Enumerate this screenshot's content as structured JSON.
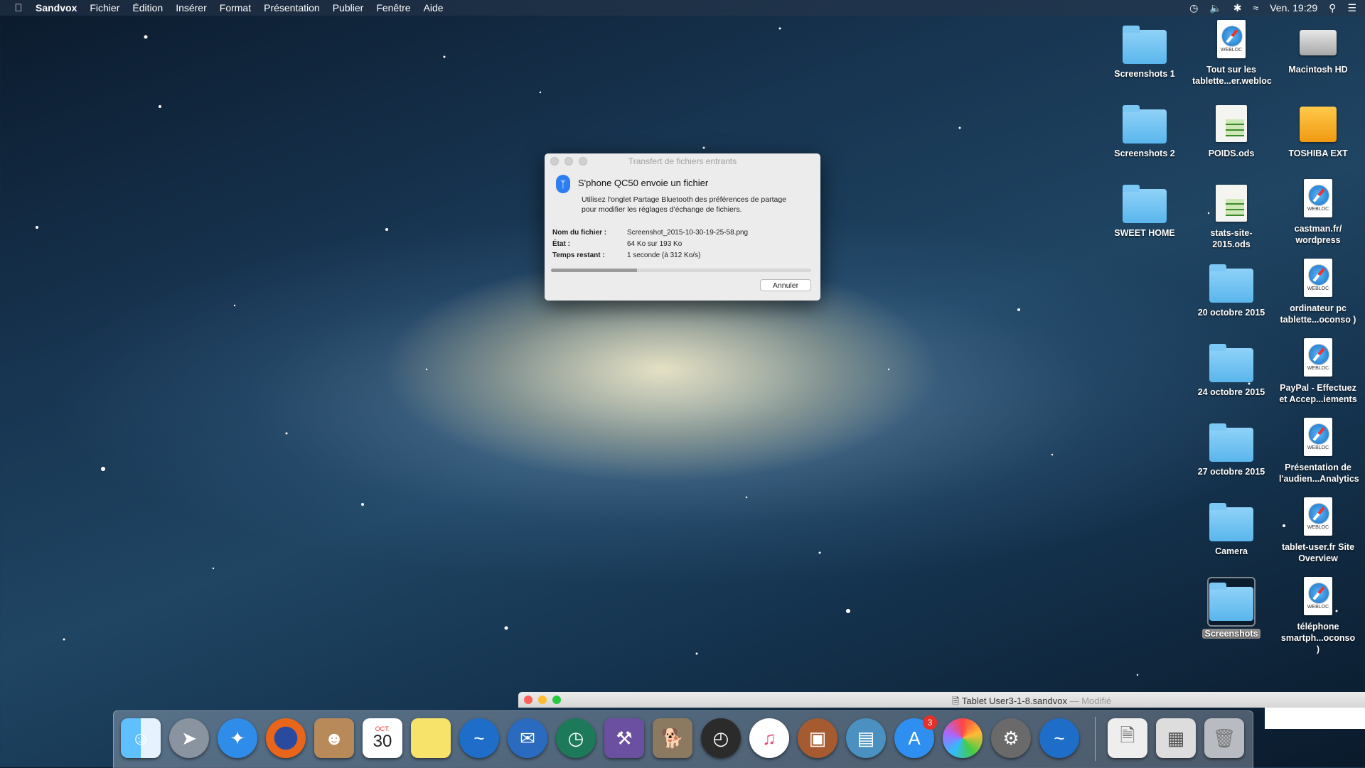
{
  "menubar": {
    "app": "Sandvox",
    "items": [
      "Fichier",
      "Édition",
      "Insérer",
      "Format",
      "Présentation",
      "Publier",
      "Fenêtre",
      "Aide"
    ],
    "clock": "Ven. 19:29",
    "status_icons": [
      "time-machine-icon",
      "volume-icon",
      "bluetooth-icon",
      "wifi-icon",
      "spotlight-icon",
      "notification-center-icon"
    ]
  },
  "desktop": {
    "col1": [
      "Screenshots 1",
      "Screenshots 2",
      "SWEET HOME"
    ],
    "col2": [
      "Tout sur les tablette...er.webloc",
      "POIDS.ods",
      "stats-site-2015.ods",
      "20 octobre 2015",
      "24 octobre 2015",
      "27 octobre 2015",
      "Camera",
      "Screenshots"
    ],
    "col3": [
      "Macintosh HD",
      "TOSHIBA EXT",
      "castman.fr/ wordpress",
      "ordinateur pc tablette...oconso )",
      "PayPal - Effectuez et Accep...iements",
      "Présentation de l'audien...Analytics",
      "tablet-user.fr Site Overview",
      "téléphone smartph...oconso )"
    ],
    "webloc_label": "WEBLOC"
  },
  "dialog": {
    "title": "Transfert de fichiers entrants",
    "heading": "S'phone QC50 envoie un fichier",
    "subtext": "Utilisez l'onglet Partage Bluetooth des préférences de partage pour modifier les réglages d'échange de fichiers.",
    "filename_label": "Nom du fichier :",
    "filename_value": "Screenshot_2015-10-30-19-25-58.png",
    "state_label": "État :",
    "state_value": "64 Ko sur 193 Ko",
    "time_label": "Temps restant :",
    "time_value": "1 seconde (à 312 Ko/s)",
    "progress": 0.33,
    "cancel_label": "Annuler"
  },
  "app_window": {
    "title": "Tablet User3-1-8.sandvox",
    "status": "— Modifié"
  },
  "dock": {
    "calendar_month": "OCT.",
    "calendar_day": "30",
    "app_store_badge": "3",
    "items": [
      "finder-icon",
      "launchpad-icon",
      "safari-icon",
      "firefox-icon",
      "contacts-icon",
      "calendar-icon",
      "notes-icon",
      "openoffice-icon",
      "thunderbird-icon",
      "time-machine-icon",
      "sandvox-icon",
      "gimp-icon",
      "dashboard-icon",
      "itunes-icon",
      "archive-utility-icon",
      "preview-icon",
      "app-store-icon",
      "photos-icon",
      "system-preferences-icon",
      "openoffice-icon-2",
      "document-icon",
      "screenshots-stack-icon",
      "trash-icon"
    ],
    "colors": {
      "finder": "#3aa0f0",
      "launchpad": "#8a93a0",
      "safari": "#2f8ce8",
      "firefox": "#e8651a",
      "contacts": "#b88a5a",
      "calendar": "#ffffff",
      "notes": "#f7e36a",
      "openoffice": "#1e6ec9",
      "thunderbird": "#2a6bc0",
      "timemachine": "#1c7a5a",
      "sandvox": "#6b4fa0",
      "gimp": "#8c7a60",
      "dashboard": "#2b2b2b",
      "itunes": "#f04a70",
      "archive": "#a55a30",
      "preview": "#4a90c0",
      "appstore": "#2f8ff0",
      "photos": "#f5f5f5",
      "syspref": "#6a6a6a"
    }
  }
}
